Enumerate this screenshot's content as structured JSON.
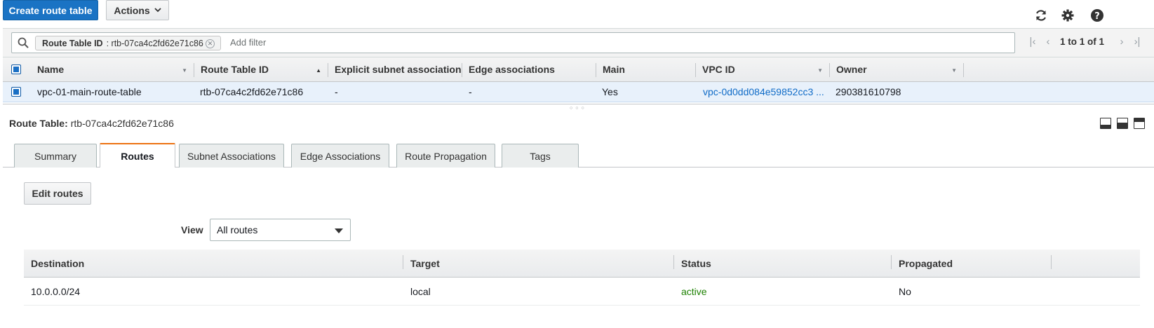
{
  "toolbar": {
    "create_label": "Create route table",
    "actions_label": "Actions"
  },
  "icons": {
    "refresh": "refresh-icon",
    "settings": "gear-icon",
    "help": "help-icon",
    "search": "search-icon"
  },
  "filter": {
    "chip_key": "Route Table ID",
    "chip_value": ": rtb-07ca4c2fd62e71c86",
    "placeholder": "Add filter"
  },
  "pagination": {
    "label": "1 to 1 of 1"
  },
  "table": {
    "headers": [
      "Name",
      "Route Table ID",
      "Explicit subnet association",
      "Edge associations",
      "Main",
      "VPC ID",
      "Owner"
    ],
    "rows": [
      {
        "name": "vpc-01-main-route-table",
        "route_table_id": "rtb-07ca4c2fd62e71c86",
        "explicit_subnet": "-",
        "edge": "-",
        "main": "Yes",
        "vpc_id": "vpc-0d0dd084e59852cc3 ...",
        "owner": "290381610798"
      }
    ]
  },
  "detail": {
    "title_key": "Route Table:",
    "title_value": "rtb-07ca4c2fd62e71c86",
    "tabs": [
      "Summary",
      "Routes",
      "Subnet Associations",
      "Edge Associations",
      "Route Propagation",
      "Tags"
    ],
    "active_tab": "Routes",
    "edit_routes_label": "Edit routes",
    "view_label": "View",
    "view_value": "All routes"
  },
  "routes": {
    "headers": [
      "Destination",
      "Target",
      "Status",
      "Propagated"
    ],
    "rows": [
      {
        "destination": "10.0.0.0/24",
        "target": "local",
        "status": "active",
        "propagated": "No"
      }
    ]
  },
  "colors": {
    "primary": "#1a73c4",
    "active_tab_accent": "#ec7211",
    "link": "#0f6bc7",
    "status_active": "#1d8102",
    "selected_row": "#e8f1fb"
  }
}
